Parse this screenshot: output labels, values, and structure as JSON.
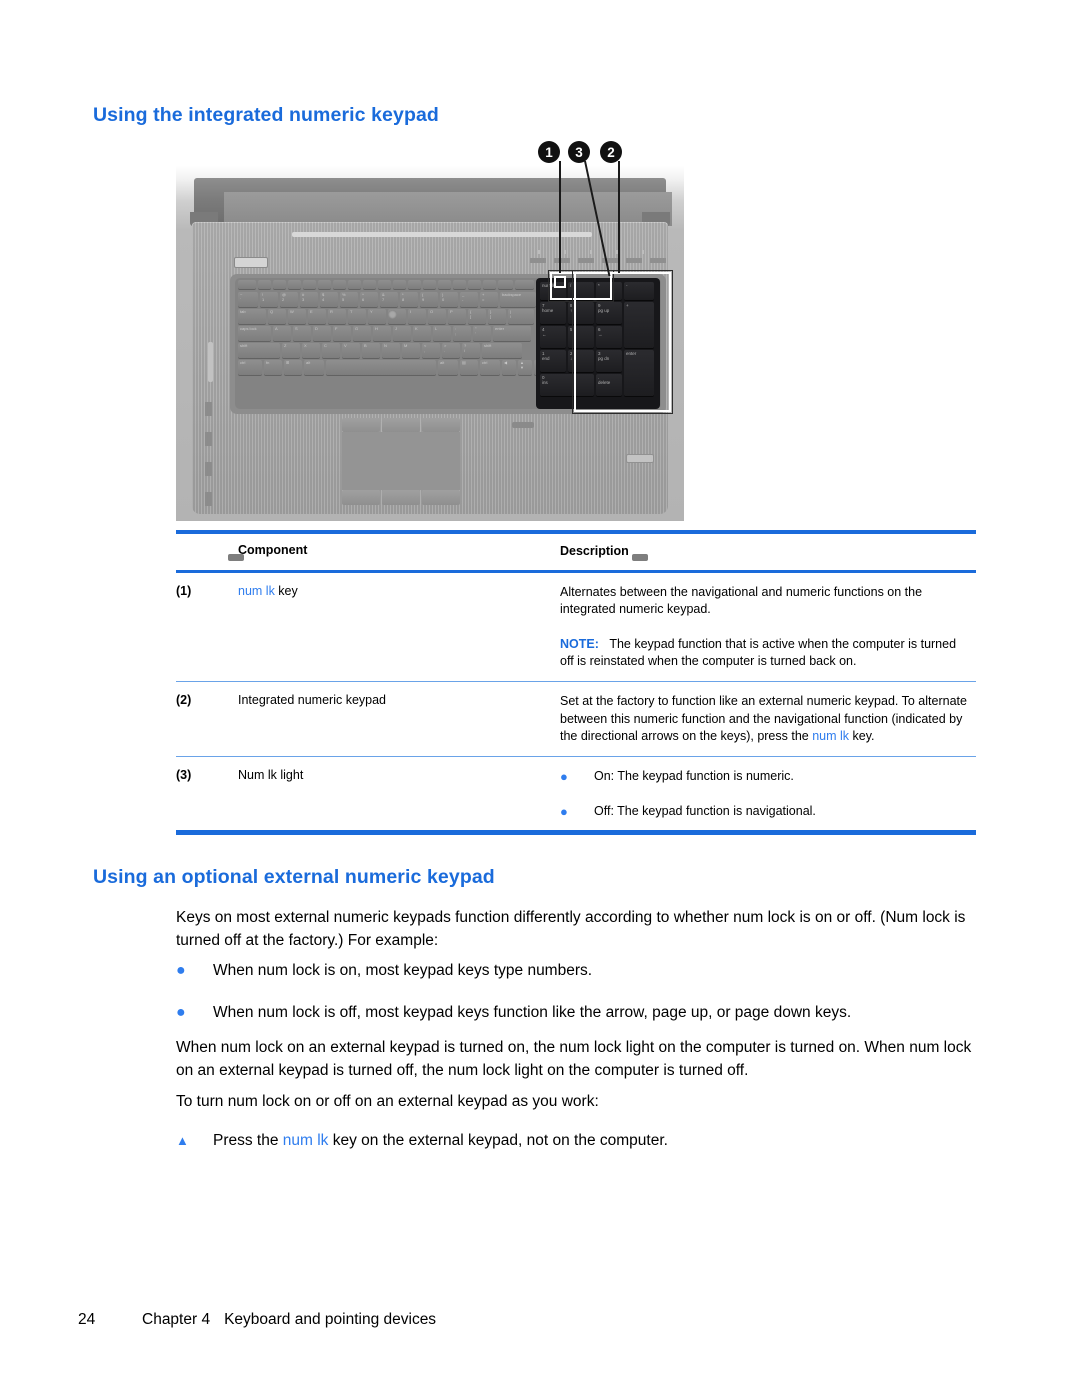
{
  "page": {
    "heading_keypad": "Using the integrated numeric keypad",
    "heading_external": "Using an optional external numeric keypad"
  },
  "figure": {
    "name": "laptop-keyboard-illustration",
    "callouts": [
      {
        "id": "1",
        "label": "1"
      },
      {
        "id": "3",
        "label": "3"
      },
      {
        "id": "2",
        "label": "2"
      }
    ],
    "numpad_keys": [
      [
        "",
        "/",
        "*",
        "-"
      ],
      [
        "7\nhome",
        "8\n↑",
        "9\npg up",
        "+"
      ],
      [
        "4\n←",
        "5",
        "6\n→",
        ""
      ],
      [
        "1\nend",
        "2\n↓",
        "3\npg dn",
        "enter"
      ],
      [
        "0\nins",
        "",
        ".\ndelete",
        ""
      ]
    ]
  },
  "table": {
    "headers": {
      "component": "Component",
      "description": "Description"
    },
    "rows": [
      {
        "num": "(1)",
        "component_pre": "num lk",
        "component_post": " key",
        "desc_main": "Alternates between the navigational and numeric functions on the integrated numeric keypad.",
        "note_label": "NOTE:",
        "note_text": "The keypad function that is active when the computer is turned off is reinstated when the computer is turned back on."
      },
      {
        "num": "(2)",
        "component": "Integrated numeric keypad",
        "desc_a": "Set at the factory to function like an external numeric keypad. To alternate between this numeric function and the navigational function (indicated by the directional arrows on the keys), press the ",
        "desc_link": "num lk",
        "desc_b": " key."
      },
      {
        "num": "(3)",
        "component": "Num lk light",
        "bullets": [
          "On: The keypad function is numeric.",
          "Off: The keypad function is navigational."
        ],
        "bullet_glyph": "●"
      }
    ]
  },
  "body": {
    "intro": "Keys on most external numeric keypads function differently according to whether num lock is on or off. (Num lock is turned off at the factory.) For example:",
    "bullets": [
      "When num lock is on, most keypad keys type numbers.",
      "When num lock is off, most keypad keys function like the arrow, page up, or page down keys."
    ],
    "bullet_glyph": "●",
    "lights_para": "When num lock on an external keypad is turned on, the num lock light on the computer is turned on. When num lock on an external keypad is turned off, the num lock light on the computer is turned off.",
    "toturn_para": "To turn num lock on or off on an external keypad as you work:",
    "step": {
      "glyph": "▲",
      "pre": "Press the ",
      "link": "num lk",
      "post": " key on the external keypad, not on the computer."
    }
  },
  "footer": {
    "page_number": "24",
    "chapter": "Chapter 4",
    "chapter_title": "Keyboard and pointing devices"
  },
  "colors": {
    "heading_blue": "#1a6bdb",
    "link_blue": "#2f7dee",
    "rule_blue": "#1a6bdb",
    "rule_blue_light": "#6aa3e8"
  }
}
